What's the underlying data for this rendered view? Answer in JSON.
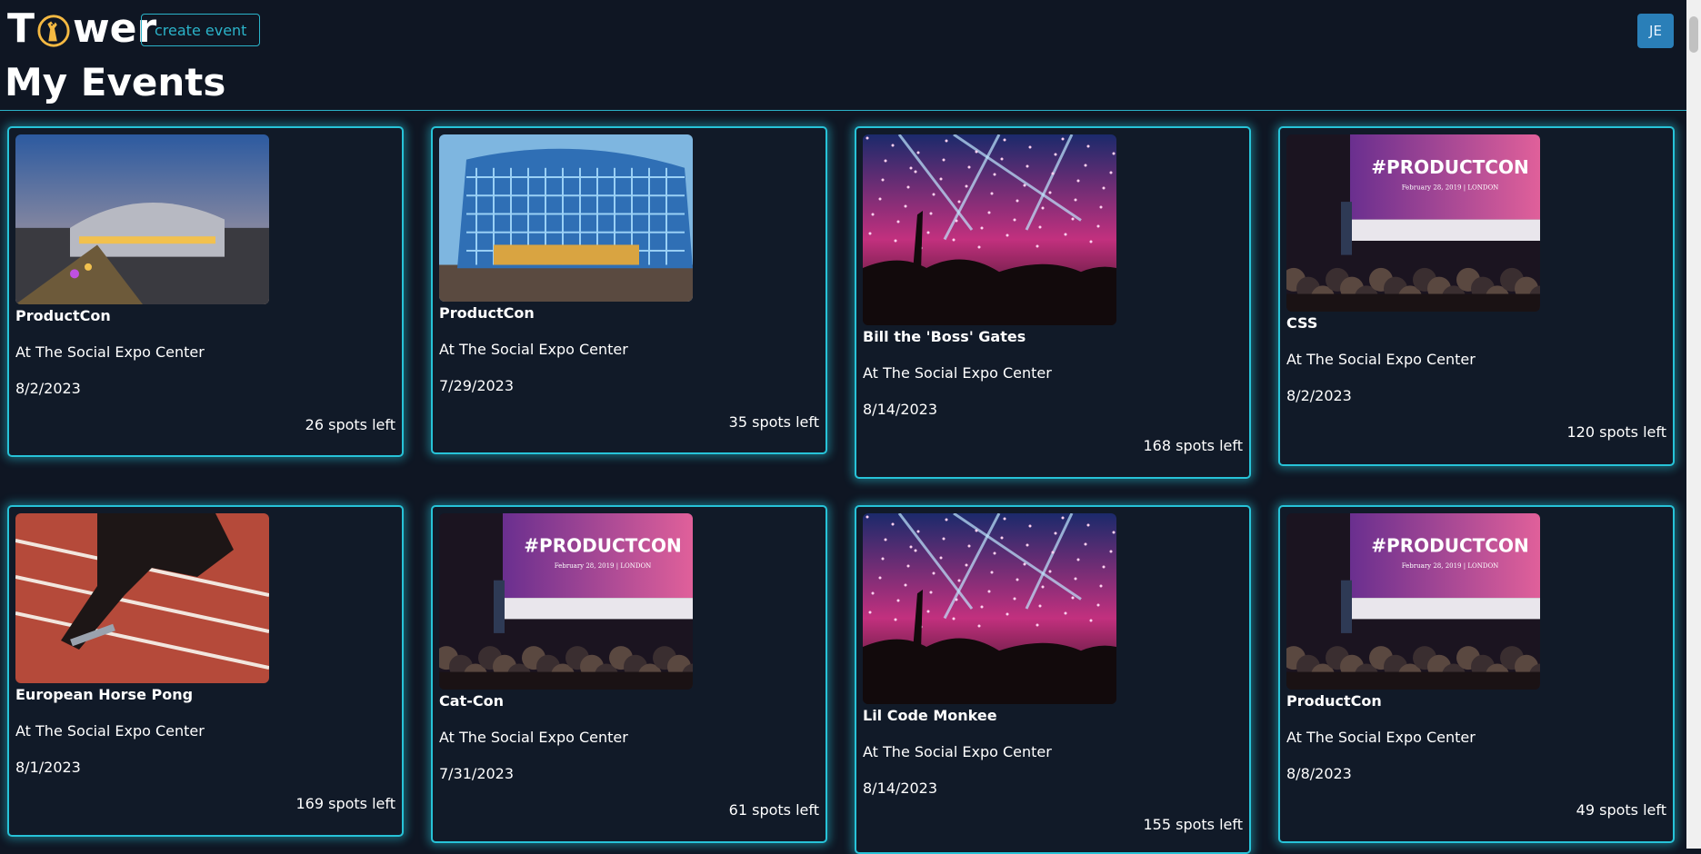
{
  "app": {
    "title_prefix": "T",
    "title_suffix": "wer",
    "create_label": "create event",
    "user_initials": "JE"
  },
  "page": {
    "title": "My Events"
  },
  "events": [
    {
      "name": "ProductCon",
      "location": "At The Social Expo Center",
      "date": "8/2/2023",
      "spots": "26 spots left",
      "image": "arena-dusk"
    },
    {
      "name": "ProductCon",
      "location": "At The Social Expo Center",
      "date": "7/29/2023",
      "spots": "35 spots left",
      "image": "glass-building"
    },
    {
      "name": "Bill the 'Boss' Gates",
      "location": "At The Social Expo Center",
      "date": "8/14/2023",
      "spots": "168 spots left",
      "image": "concert-crowd"
    },
    {
      "name": "CSS",
      "location": "At The Social Expo Center",
      "date": "8/2/2023",
      "spots": "120 spots left",
      "image": "productcon-stage"
    },
    {
      "name": "European Horse Pong",
      "location": "At The Social Expo Center",
      "date": "8/1/2023",
      "spots": "169 spots left",
      "image": "running-track"
    },
    {
      "name": "Cat-Con",
      "location": "At The Social Expo Center",
      "date": "7/31/2023",
      "spots": "61 spots left",
      "image": "productcon-stage"
    },
    {
      "name": "Lil Code Monkee",
      "location": "At The Social Expo Center",
      "date": "8/14/2023",
      "spots": "155 spots left",
      "image": "concert-crowd"
    },
    {
      "name": "ProductCon",
      "location": "At The Social Expo Center",
      "date": "8/8/2023",
      "spots": "49 spots left",
      "image": "productcon-stage"
    }
  ],
  "stage_banner": {
    "headline": "#PRODUCTCON",
    "subline": "February 28, 2019 | LONDON"
  },
  "colors": {
    "accent": "#27c3d8",
    "background": "#0f1623",
    "avatar": "#2a7fb8"
  }
}
